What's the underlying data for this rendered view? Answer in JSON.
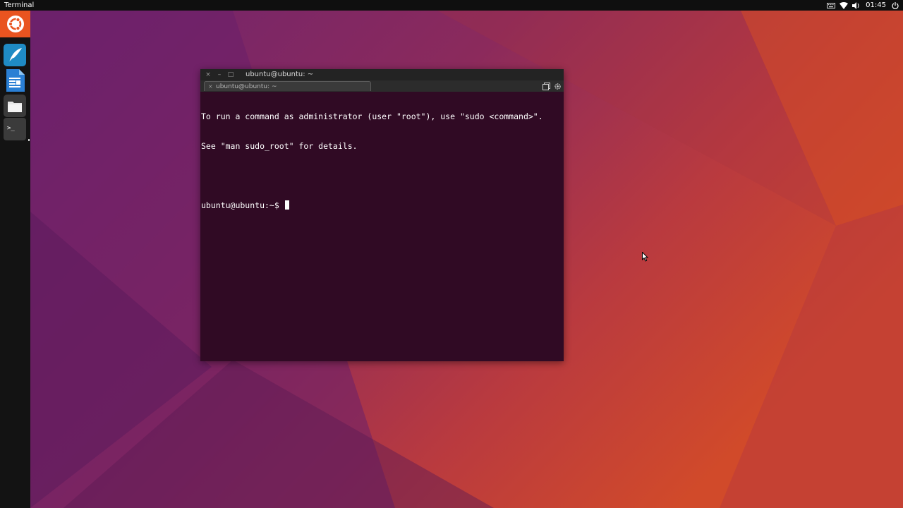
{
  "top_panel": {
    "app_title": "Terminal",
    "clock": "01:45",
    "tray_icons": [
      "keyboard-icon",
      "wifi-icon",
      "volume-icon",
      "power-icon"
    ]
  },
  "dock": {
    "items": [
      {
        "name": "ubuntu-home-icon"
      },
      {
        "name": "writer-app-icon"
      },
      {
        "name": "libreoffice-writer-icon"
      },
      {
        "name": "files-icon"
      },
      {
        "name": "terminal-icon",
        "glyph": ">_"
      }
    ]
  },
  "terminal": {
    "window_title": "ubuntu@ubuntu: ~",
    "tab_label": "ubuntu@ubuntu: ~",
    "close_glyph": "×",
    "minimize_glyph": "–",
    "maximize_glyph": "□",
    "lines": [
      "To run a command as administrator (user \"root\"), use \"sudo <command>\".",
      "See \"man sudo_root\" for details.",
      "",
      "ubuntu@ubuntu:~$ "
    ]
  },
  "colors": {
    "terminal_bg": "#300a24",
    "accent": "#e95420",
    "panel_bg": "#0f0f0f",
    "dock_bg": "#131313"
  }
}
